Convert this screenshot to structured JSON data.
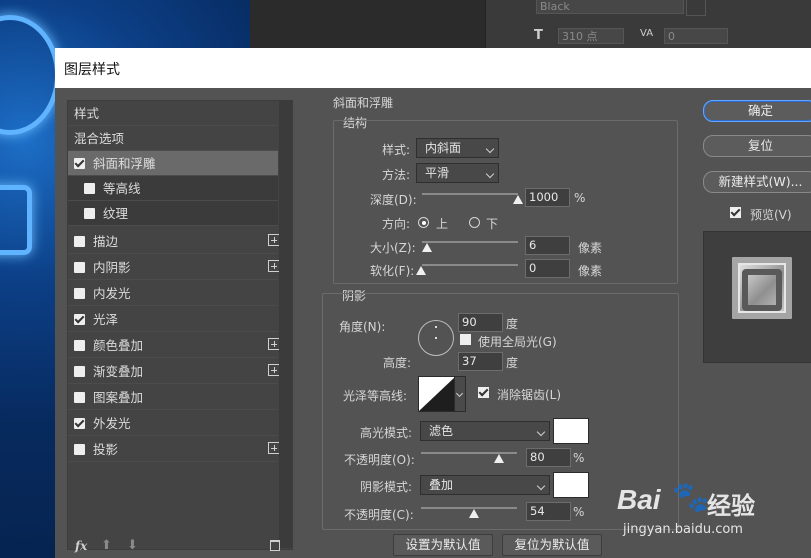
{
  "background": {
    "font_value": "Black",
    "font_size": "310 点",
    "tracking": "0"
  },
  "dialog": {
    "title": "图层样式",
    "list": {
      "header": "样式",
      "items": [
        {
          "label": "混合选项",
          "checkbox": false,
          "checked": false,
          "plus": false
        },
        {
          "label": "斜面和浮雕",
          "checkbox": true,
          "checked": true,
          "plus": false,
          "selected": true
        },
        {
          "label": "等高线",
          "checkbox": true,
          "checked": false,
          "plus": false
        },
        {
          "label": "纹理",
          "checkbox": true,
          "checked": false,
          "plus": false
        },
        {
          "label": "描边",
          "checkbox": true,
          "checked": false,
          "plus": true
        },
        {
          "label": "内阴影",
          "checkbox": true,
          "checked": false,
          "plus": true
        },
        {
          "label": "内发光",
          "checkbox": true,
          "checked": false,
          "plus": false
        },
        {
          "label": "光泽",
          "checkbox": true,
          "checked": true,
          "plus": false
        },
        {
          "label": "颜色叠加",
          "checkbox": true,
          "checked": false,
          "plus": true
        },
        {
          "label": "渐变叠加",
          "checkbox": true,
          "checked": false,
          "plus": true
        },
        {
          "label": "图案叠加",
          "checkbox": true,
          "checked": false,
          "plus": false
        },
        {
          "label": "外发光",
          "checkbox": true,
          "checked": true,
          "plus": false
        },
        {
          "label": "投影",
          "checkbox": true,
          "checked": false,
          "plus": true
        }
      ],
      "footer_fx": "fx"
    },
    "bevel": {
      "section_title": "斜面和浮雕",
      "structure_title": "结构",
      "style_label": "样式:",
      "style_value": "内斜面",
      "technique_label": "方法:",
      "technique_value": "平滑",
      "depth_label": "深度(D):",
      "depth_value": "1000",
      "depth_unit": "%",
      "depth_level": 1.0,
      "direction_label": "方向:",
      "direction_up": "上",
      "direction_down": "下",
      "size_label": "大小(Z):",
      "size_value": "6",
      "size_unit": "像素",
      "soften_label": "软化(F):",
      "soften_value": "0",
      "soften_unit": "像素"
    },
    "shading": {
      "title": "阴影",
      "angle_label": "角度(N):",
      "angle_value": "90",
      "angle_unit": "度",
      "global_light_label": "使用全局光(G)",
      "altitude_label": "高度:",
      "altitude_value": "37",
      "altitude_unit": "度",
      "gloss_contour_label": "光泽等高线:",
      "antialias_label": "消除锯齿(L)",
      "highlight_mode_label": "高光模式:",
      "highlight_mode_value": "滤色",
      "highlight_color": "#ffffff",
      "highlight_opacity_label": "不透明度(O):",
      "highlight_opacity_value": "80",
      "highlight_opacity_unit": "%",
      "shadow_mode_label": "阴影模式:",
      "shadow_mode_value": "叠加",
      "shadow_color": "#ffffff",
      "shadow_opacity_label": "不透明度(C):",
      "shadow_opacity_value": "54",
      "shadow_opacity_unit": "%"
    },
    "buttons": {
      "make_default": "设置为默认值",
      "reset_default": "复位为默认值",
      "ok": "确定",
      "reset": "复位",
      "new_style": "新建样式(W)...",
      "preview_label": "预览(V)"
    }
  },
  "watermark": {
    "brand": "Bai",
    "brand2": "经验",
    "url": "jingyan.baidu.com"
  }
}
